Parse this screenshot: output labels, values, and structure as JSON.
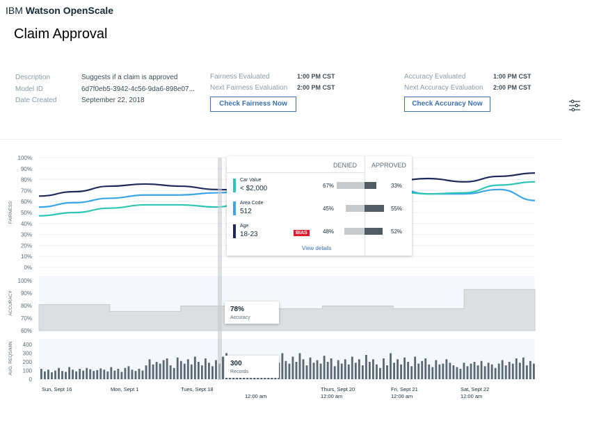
{
  "header": {
    "brand_prefix": "IBM",
    "brand_name": "Watson OpenScale",
    "page_title": "Claim Approval"
  },
  "details": {
    "description_label": "Description",
    "description_value": "Suggests if a claim is approved",
    "model_id_label": "Model ID",
    "model_id_value": "6d7f0eb5-3942-4c56-9da6-898e07...",
    "date_label": "Date Created",
    "date_value": "September 22, 2018"
  },
  "fairness": {
    "evaluated_label": "Fairness Evaluated",
    "evaluated_value": "1:00 PM CST",
    "next_label": "Next Fairness Evaluation",
    "next_value": "2:00 PM CST",
    "button": "Check Fairness Now"
  },
  "accuracy": {
    "evaluated_label": "Accuracy Evaluated",
    "evaluated_value": "1:00 PM CST",
    "next_label": "Next Accuracy Evaluation",
    "next_value": "2:00 PM CST",
    "button": "Check Accuracy Now"
  },
  "icons": {
    "settings": "sliders-icon"
  },
  "chart_data": [
    {
      "type": "line",
      "ylabel": "FAIRNESS",
      "y_ticks": [
        "100%",
        "90%",
        "80%",
        "70%",
        "60%",
        "50%",
        "40%",
        "30%",
        "20%",
        "10%",
        "0%"
      ],
      "ylim": [
        0,
        100
      ],
      "x": [
        0,
        1,
        2,
        3,
        4,
        5,
        6,
        7,
        8,
        9,
        10,
        11,
        12,
        13,
        14
      ],
      "series": [
        {
          "color": "#1f2a5c",
          "values": [
            65,
            69,
            74,
            76,
            74,
            71,
            70,
            71,
            73,
            76,
            79,
            81,
            78,
            83,
            86
          ]
        },
        {
          "color": "#3ba5e7",
          "values": [
            55,
            59,
            63,
            66,
            66,
            68,
            70,
            71,
            74,
            74,
            72,
            67,
            67,
            71,
            61
          ]
        },
        {
          "color": "#2dc5b3",
          "values": [
            47,
            50,
            54,
            57,
            57,
            55,
            61,
            66,
            71,
            70,
            69,
            67,
            68,
            75,
            78
          ]
        }
      ],
      "tooltip": {
        "denied_header": "DENIED",
        "approved_header": "APPROVED",
        "rows": [
          {
            "label": "Car Value",
            "value": "< $2,000",
            "color": "#2dc5b3",
            "denied": "67%",
            "approved": "33%",
            "denied_num": 67,
            "approved_num": 33,
            "bias": ""
          },
          {
            "label": "Area Code",
            "value": "512",
            "color": "#3ba5e7",
            "denied": "45%",
            "approved": "55%",
            "denied_num": 45,
            "approved_num": 55,
            "bias": ""
          },
          {
            "label": "Age",
            "value": "18-23",
            "color": "#1f2a5c",
            "denied": "48%",
            "approved": "52%",
            "denied_num": 48,
            "approved_num": 52,
            "bias": "BIAS"
          }
        ],
        "link": "View details"
      }
    },
    {
      "type": "area",
      "ylabel": "ACCURACY",
      "y_ticks": [
        "100%",
        "90%",
        "80%",
        "70%",
        "60%"
      ],
      "ylim": [
        60,
        100
      ],
      "segments": [
        79,
        74,
        78,
        76,
        78,
        76,
        90
      ],
      "callout_value": "78%",
      "callout_label": "Accuracy"
    },
    {
      "type": "bar",
      "ylabel": "AVG. REQS/MIN",
      "y_ticks": [
        "400",
        "300",
        "200",
        "100",
        "0"
      ],
      "ylim": [
        0,
        400
      ],
      "values": [
        120,
        90,
        110,
        80,
        100,
        130,
        95,
        85,
        140,
        110,
        90,
        120,
        100,
        130,
        115,
        95,
        105,
        125,
        110,
        90,
        140,
        100,
        120,
        85,
        130,
        150,
        110,
        95,
        120,
        100,
        160,
        230,
        170,
        200,
        180,
        220,
        240,
        160,
        130,
        250,
        210,
        180,
        230,
        170,
        260,
        200,
        160,
        240,
        190,
        150,
        220,
        180,
        260,
        300,
        210,
        170,
        240,
        190,
        130,
        230,
        180,
        260,
        150,
        200,
        250,
        170,
        140,
        220,
        190,
        300,
        210,
        180,
        260,
        200,
        300,
        230,
        160,
        250,
        190,
        220,
        180,
        270,
        200,
        240,
        150,
        220,
        180,
        230,
        170,
        260,
        190,
        230,
        160,
        280,
        200,
        230,
        170,
        130,
        240,
        160,
        300,
        190,
        230,
        170,
        250,
        200,
        150,
        260,
        180,
        210,
        240,
        170,
        140,
        220,
        170,
        180,
        230,
        190,
        160,
        140,
        120,
        190,
        150,
        180,
        200,
        160,
        210,
        150,
        190,
        170,
        130,
        180,
        220,
        160,
        200,
        180,
        240,
        190,
        250,
        160,
        210,
        180
      ],
      "callout_value": "300",
      "callout_label": "Records",
      "x_labels": [
        {
          "line1": "Sun, Sept 16",
          "line2": ""
        },
        {
          "line1": "Mon, Sept 1",
          "line2": ""
        },
        {
          "line1": "Tues, Sept 18",
          "line2": ""
        },
        {
          "line1": "",
          "line2": "12:00 am"
        },
        {
          "line1": "Thurs, Sept 20",
          "line2": "12:00 am"
        },
        {
          "line1": "Fri, Sept 21",
          "line2": "12:00 am"
        },
        {
          "line1": "Sat, Sept 22",
          "line2": "12:00 am"
        }
      ]
    }
  ]
}
